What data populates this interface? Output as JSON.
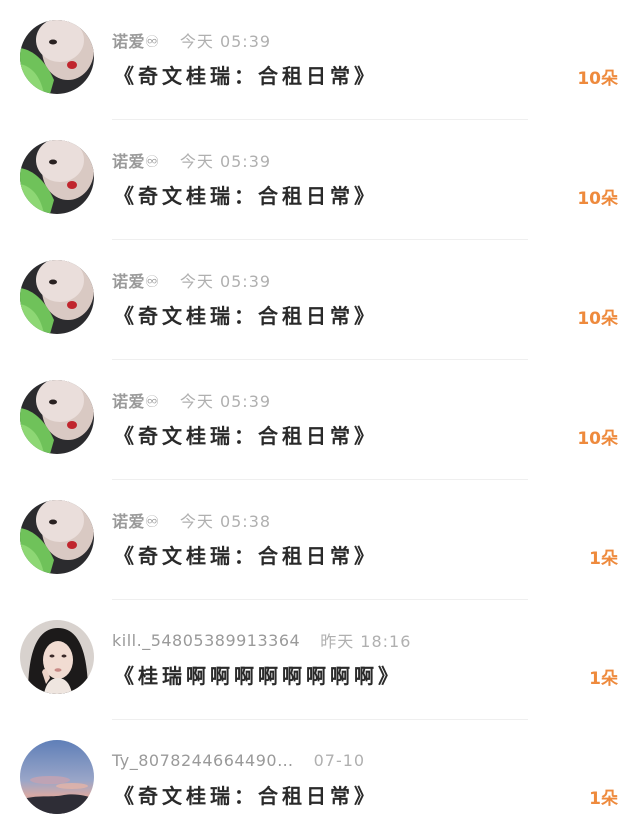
{
  "gifts": [
    {
      "name": "诺爱♾",
      "time": "今天 05:39",
      "title": "《奇文桂瑞：合租日常》",
      "count": "10朵",
      "avatar": "green-sweater-selfie"
    },
    {
      "name": "诺爱♾",
      "time": "今天 05:39",
      "title": "《奇文桂瑞：合租日常》",
      "count": "10朵",
      "avatar": "green-sweater-selfie"
    },
    {
      "name": "诺爱♾",
      "time": "今天 05:39",
      "title": "《奇文桂瑞：合租日常》",
      "count": "10朵",
      "avatar": "green-sweater-selfie"
    },
    {
      "name": "诺爱♾",
      "time": "今天 05:39",
      "title": "《奇文桂瑞：合租日常》",
      "count": "10朵",
      "avatar": "green-sweater-selfie"
    },
    {
      "name": "诺爱♾",
      "time": "今天 05:38",
      "title": "《奇文桂瑞：合租日常》",
      "count": "1朵",
      "avatar": "green-sweater-selfie"
    },
    {
      "name": "kill._54805389913364",
      "time": "昨天 18:16",
      "title": "《桂瑞啊啊啊啊啊啊啊啊》",
      "count": "1朵",
      "avatar": "dark-hair-portrait"
    },
    {
      "name": "Ty_8078244664490…",
      "time": "07-10",
      "title": "《奇文桂瑞：合租日常》",
      "count": "1朵",
      "avatar": "dusk-sky"
    }
  ],
  "colors": {
    "count_accent": "#ee8a3d",
    "title_text": "#2a2a2a",
    "meta_text": "#9a9a9a"
  }
}
